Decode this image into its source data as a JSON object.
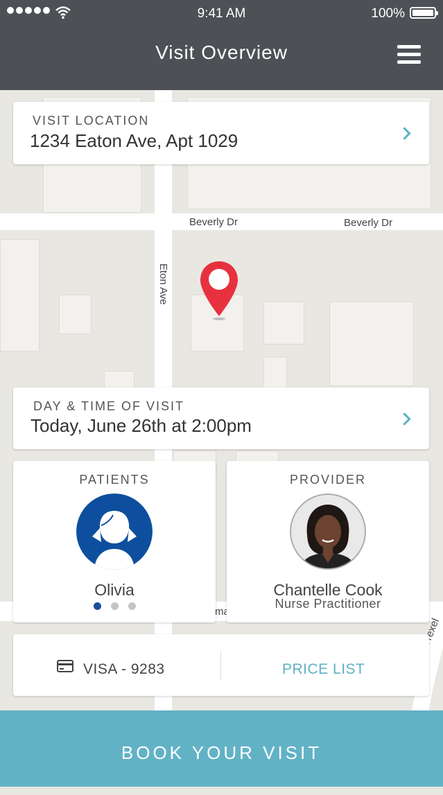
{
  "status_bar": {
    "time": "9:41 AM",
    "battery": "100%"
  },
  "nav": {
    "title": "Visit Overview",
    "menu_icon": "hamburger-icon"
  },
  "map": {
    "streets": [
      "Beverly Dr",
      "Beverly Dr",
      "Eton Ave",
      "ma",
      "Drexel"
    ],
    "pin_color": "#e8313f"
  },
  "visit_location": {
    "caption": "VISIT LOCATION",
    "value": "1234 Eaton Ave, Apt 1029"
  },
  "visit_time": {
    "caption": "DAY & TIME OF VISIT",
    "value": "Today, June 26th at 2:00pm"
  },
  "patients": {
    "caption": "PATIENTS",
    "name": "Olivia",
    "page_count": 3,
    "active_page": 1,
    "avatar_color": "#0d4f9e"
  },
  "provider": {
    "caption": "PROVIDER",
    "name": "Chantelle Cook",
    "role": "Nurse Practitioner"
  },
  "payment": {
    "card_label": "VISA - 9283",
    "price_list": "PRICE LIST"
  },
  "cta": {
    "label": "BOOK YOUR VISIT",
    "color": "#62b2c6"
  },
  "colors": {
    "header": "#4d5055",
    "accent": "#5fb1c4"
  }
}
